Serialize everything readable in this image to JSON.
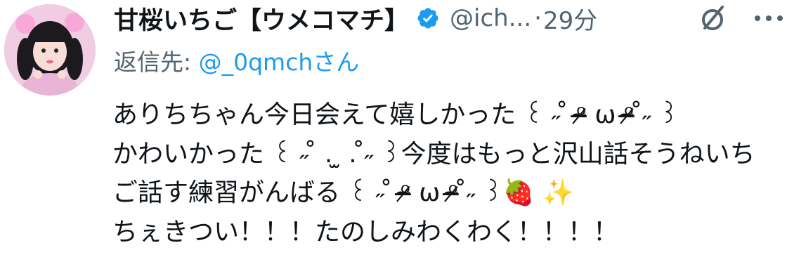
{
  "author": {
    "display_name": "甘桜いちご【ウメコマチ】",
    "handle": "@ich...",
    "separator": "·",
    "time": "29分",
    "verified_color": "#1d9bf0"
  },
  "reply": {
    "prefix": "返信先: ",
    "target": "@_0qmchさん"
  },
  "tweet": {
    "lines": [
      "ありちちゃん今日会えて嬉しかった ꒰ ˶ ̊ ᵒ̴̶̷ ω ᵒ̴̶̷ ̊˶ ꒱",
      "かわいかった ꒰ ˶ ̊ . ̫ . ̊˶ ꒱今度はもっと沢山話そうねいち",
      "ご話す練習がんばる ꒰ ˶ ̊ ᵒ̴̶̷ ω ᵒ̴̶̷ ̊˶ ꒱🍓 ✨",
      "ちぇきつい！！！たのしみわくわく！！！！"
    ]
  },
  "icons": {
    "verified": "verified-badge-icon",
    "grok": "grok-icon",
    "more": "more-options-icon"
  }
}
